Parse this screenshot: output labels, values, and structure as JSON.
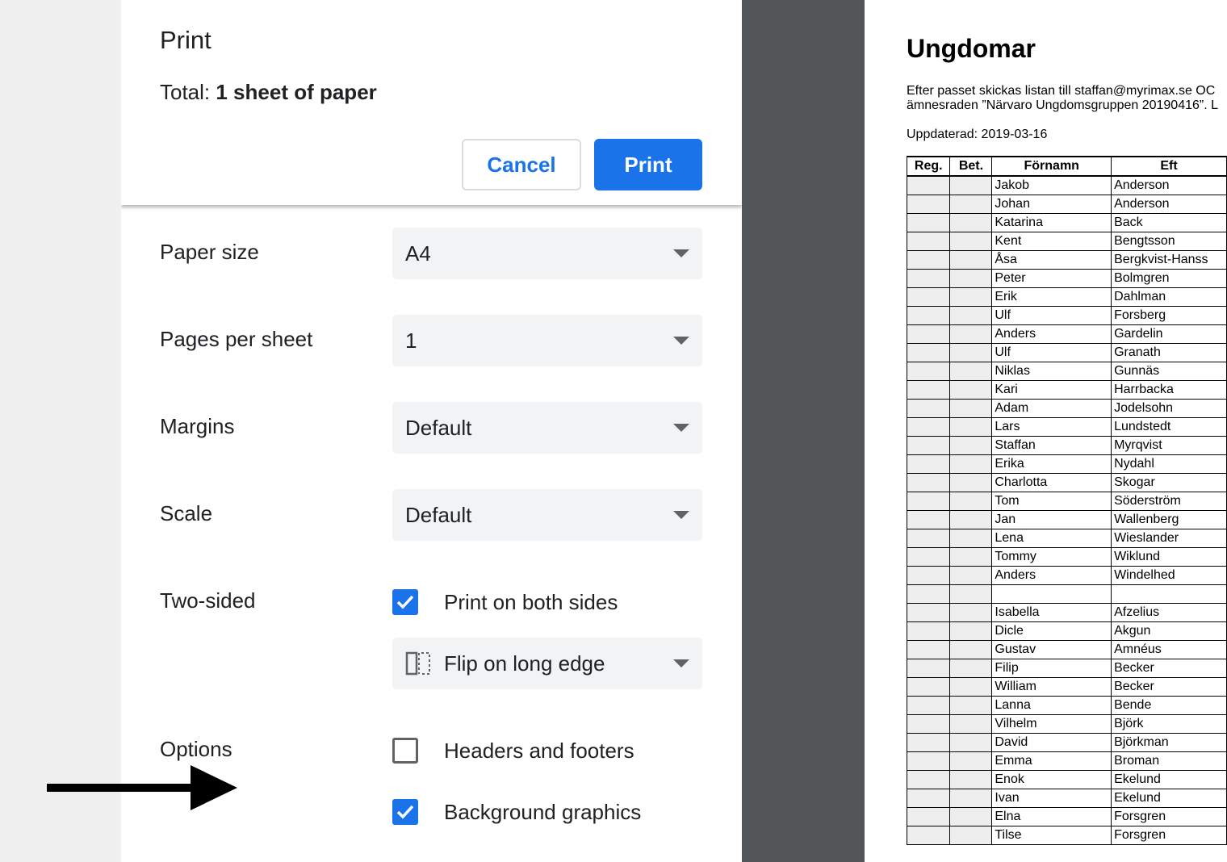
{
  "dialog": {
    "title": "Print",
    "total_label": "Total: ",
    "total_value": "1 sheet of paper",
    "cancel_label": "Cancel",
    "print_label": "Print"
  },
  "settings": {
    "paper_size": {
      "label": "Paper size",
      "value": "A4"
    },
    "pages_per_sheet": {
      "label": "Pages per sheet",
      "value": "1"
    },
    "margins": {
      "label": "Margins",
      "value": "Default"
    },
    "scale": {
      "label": "Scale",
      "value": "Default"
    },
    "two_sided": {
      "label": "Two-sided",
      "checkbox_label": "Print on both sides",
      "checked": true,
      "flip_value": "Flip on long edge",
      "flip_icon": "flip-long-edge-icon"
    },
    "options": {
      "label": "Options",
      "headers_footers": {
        "label": "Headers and footers",
        "checked": false
      },
      "background_graphics": {
        "label": "Background graphics",
        "checked": true
      }
    }
  },
  "annotation": {
    "icon": "arrow-right-icon"
  },
  "preview": {
    "title": "Ungdomar",
    "line1": "Efter passet skickas listan till staffan@myrimax.se OC",
    "line2": "ämnesraden ”Närvaro Ungdomsgruppen 20190416”. L",
    "updated": "Uppdaterad: 2019-03-16",
    "headers": [
      "Reg.",
      "Bet.",
      "Förnamn",
      "Eft"
    ],
    "rows": [
      [
        "Jakob",
        "Anderson"
      ],
      [
        "Johan",
        "Anderson"
      ],
      [
        "Katarina",
        "Back"
      ],
      [
        "Kent",
        "Bengtsson"
      ],
      [
        "Åsa",
        "Bergkvist-Hanss"
      ],
      [
        "Peter",
        "Bolmgren"
      ],
      [
        "Erik",
        "Dahlman"
      ],
      [
        "Ulf",
        "Forsberg"
      ],
      [
        "Anders",
        "Gardelin"
      ],
      [
        "Ulf",
        "Granath"
      ],
      [
        "Niklas",
        "Gunnäs"
      ],
      [
        "Kari",
        "Harrbacka"
      ],
      [
        "Adam",
        "Jodelsohn"
      ],
      [
        "Lars",
        "Lundstedt"
      ],
      [
        "Staffan",
        "Myrqvist"
      ],
      [
        "Erika",
        "Nydahl"
      ],
      [
        "Charlotta",
        "Skogar"
      ],
      [
        "Tom",
        "Söderström"
      ],
      [
        "Jan",
        "Wallenberg"
      ],
      [
        "Lena",
        "Wieslander"
      ],
      [
        "Tommy",
        "Wiklund"
      ],
      [
        "Anders",
        "Windelhed"
      ],
      [
        "",
        ""
      ],
      [
        "Isabella",
        "Afzelius"
      ],
      [
        "Dicle",
        "Akgun"
      ],
      [
        "Gustav",
        "Amnéus"
      ],
      [
        "Filip",
        "Becker"
      ],
      [
        "William",
        "Becker"
      ],
      [
        "Lanna",
        "Bende"
      ],
      [
        "Vilhelm",
        "Björk"
      ],
      [
        "David",
        "Björkman"
      ],
      [
        "Emma",
        "Broman"
      ],
      [
        "Enok",
        "Ekelund"
      ],
      [
        "Ivan",
        "Ekelund"
      ],
      [
        "Elna",
        "Forsgren"
      ],
      [
        "Tilse",
        "Forsgren"
      ]
    ]
  },
  "colors": {
    "accent": "#1a73e8",
    "select_bg": "#f1f3f4",
    "dark_gap": "#535659"
  }
}
